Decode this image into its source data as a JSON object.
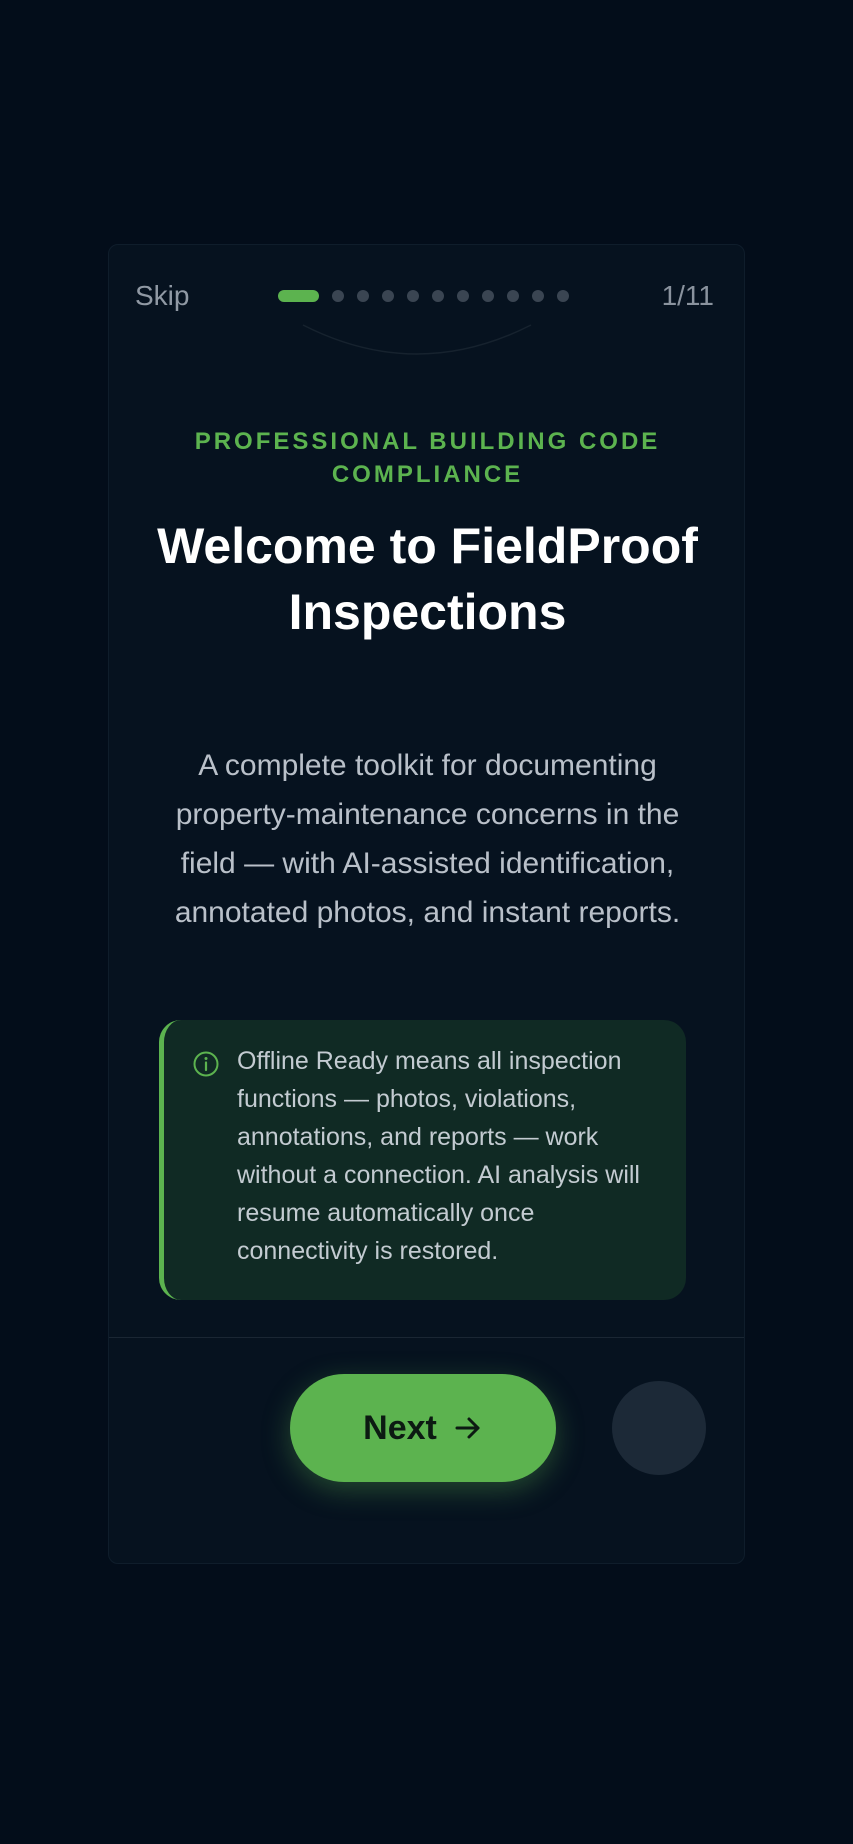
{
  "header": {
    "skip_label": "Skip",
    "counter": "1/11",
    "progress": {
      "current": 1,
      "total": 11
    }
  },
  "slide": {
    "eyebrow": "PROFESSIONAL BUILDING CODE COMPLIANCE",
    "title": "Welcome to FieldProof Inspections",
    "description": "A complete toolkit for documenting property-maintenance concerns in the field — with AI-assisted identification, annotated photos, and instant reports."
  },
  "notice": {
    "icon": "info-icon",
    "text": "Offline Ready means all inspection functions — photos, violations, annotations, and reports — work without a connection. AI analysis will resume automatically once connectivity is restored."
  },
  "footer": {
    "next_label": "Next",
    "next_icon": "arrow-right-icon"
  },
  "colors": {
    "background": "#030d1a",
    "card": "#06121f",
    "accent": "#5cb34f",
    "notice_bg": "#102a24",
    "dot_inactive": "#3a4552"
  }
}
